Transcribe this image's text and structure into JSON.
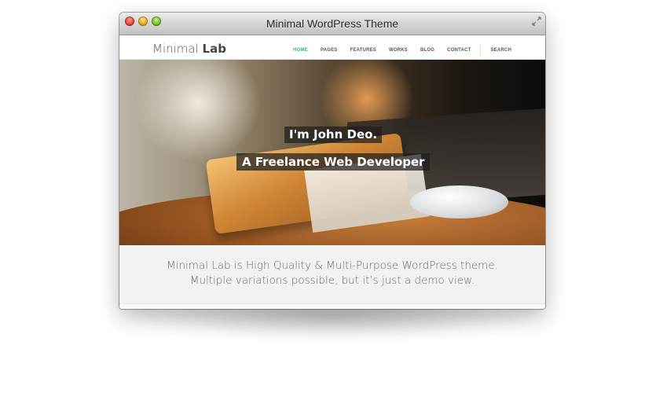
{
  "window": {
    "title": "Minimal WordPress Theme",
    "buttons": {
      "close": "close-icon",
      "minimize": "minimize-icon",
      "zoom": "zoom-icon"
    },
    "fullscreen_icon": "fullscreen-icon"
  },
  "site": {
    "logo_light": "Minimal ",
    "logo_bold": "Lab",
    "nav": [
      {
        "label": "HOME",
        "active": true
      },
      {
        "label": "PAGES"
      },
      {
        "label": "FEATURES"
      },
      {
        "label": "WORKS"
      },
      {
        "label": "BLOG"
      },
      {
        "label": "CONTACT"
      }
    ],
    "search_label": "SEARCH",
    "accent_color": "#35b38f"
  },
  "hero": {
    "line1": "I'm John Deo.",
    "line2": "A Freelance Web Developer"
  },
  "tagline": {
    "line1": "Minimal Lab is High Quality & Multi-Purpose WordPress theme.",
    "line2": "Multiple variations possible, but it’s just a demo view."
  }
}
